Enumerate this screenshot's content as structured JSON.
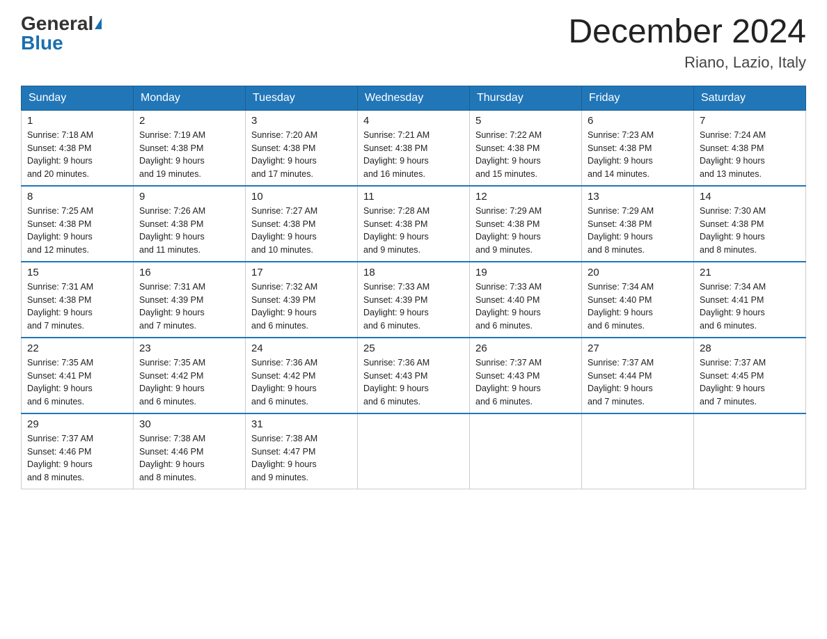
{
  "logo": {
    "general": "General",
    "blue": "Blue"
  },
  "title": "December 2024",
  "location": "Riano, Lazio, Italy",
  "days_of_week": [
    "Sunday",
    "Monday",
    "Tuesday",
    "Wednesday",
    "Thursday",
    "Friday",
    "Saturday"
  ],
  "weeks": [
    [
      {
        "day": "1",
        "sunrise": "7:18 AM",
        "sunset": "4:38 PM",
        "daylight": "9 hours and 20 minutes."
      },
      {
        "day": "2",
        "sunrise": "7:19 AM",
        "sunset": "4:38 PM",
        "daylight": "9 hours and 19 minutes."
      },
      {
        "day": "3",
        "sunrise": "7:20 AM",
        "sunset": "4:38 PM",
        "daylight": "9 hours and 17 minutes."
      },
      {
        "day": "4",
        "sunrise": "7:21 AM",
        "sunset": "4:38 PM",
        "daylight": "9 hours and 16 minutes."
      },
      {
        "day": "5",
        "sunrise": "7:22 AM",
        "sunset": "4:38 PM",
        "daylight": "9 hours and 15 minutes."
      },
      {
        "day": "6",
        "sunrise": "7:23 AM",
        "sunset": "4:38 PM",
        "daylight": "9 hours and 14 minutes."
      },
      {
        "day": "7",
        "sunrise": "7:24 AM",
        "sunset": "4:38 PM",
        "daylight": "9 hours and 13 minutes."
      }
    ],
    [
      {
        "day": "8",
        "sunrise": "7:25 AM",
        "sunset": "4:38 PM",
        "daylight": "9 hours and 12 minutes."
      },
      {
        "day": "9",
        "sunrise": "7:26 AM",
        "sunset": "4:38 PM",
        "daylight": "9 hours and 11 minutes."
      },
      {
        "day": "10",
        "sunrise": "7:27 AM",
        "sunset": "4:38 PM",
        "daylight": "9 hours and 10 minutes."
      },
      {
        "day": "11",
        "sunrise": "7:28 AM",
        "sunset": "4:38 PM",
        "daylight": "9 hours and 9 minutes."
      },
      {
        "day": "12",
        "sunrise": "7:29 AM",
        "sunset": "4:38 PM",
        "daylight": "9 hours and 9 minutes."
      },
      {
        "day": "13",
        "sunrise": "7:29 AM",
        "sunset": "4:38 PM",
        "daylight": "9 hours and 8 minutes."
      },
      {
        "day": "14",
        "sunrise": "7:30 AM",
        "sunset": "4:38 PM",
        "daylight": "9 hours and 8 minutes."
      }
    ],
    [
      {
        "day": "15",
        "sunrise": "7:31 AM",
        "sunset": "4:38 PM",
        "daylight": "9 hours and 7 minutes."
      },
      {
        "day": "16",
        "sunrise": "7:31 AM",
        "sunset": "4:39 PM",
        "daylight": "9 hours and 7 minutes."
      },
      {
        "day": "17",
        "sunrise": "7:32 AM",
        "sunset": "4:39 PM",
        "daylight": "9 hours and 6 minutes."
      },
      {
        "day": "18",
        "sunrise": "7:33 AM",
        "sunset": "4:39 PM",
        "daylight": "9 hours and 6 minutes."
      },
      {
        "day": "19",
        "sunrise": "7:33 AM",
        "sunset": "4:40 PM",
        "daylight": "9 hours and 6 minutes."
      },
      {
        "day": "20",
        "sunrise": "7:34 AM",
        "sunset": "4:40 PM",
        "daylight": "9 hours and 6 minutes."
      },
      {
        "day": "21",
        "sunrise": "7:34 AM",
        "sunset": "4:41 PM",
        "daylight": "9 hours and 6 minutes."
      }
    ],
    [
      {
        "day": "22",
        "sunrise": "7:35 AM",
        "sunset": "4:41 PM",
        "daylight": "9 hours and 6 minutes."
      },
      {
        "day": "23",
        "sunrise": "7:35 AM",
        "sunset": "4:42 PM",
        "daylight": "9 hours and 6 minutes."
      },
      {
        "day": "24",
        "sunrise": "7:36 AM",
        "sunset": "4:42 PM",
        "daylight": "9 hours and 6 minutes."
      },
      {
        "day": "25",
        "sunrise": "7:36 AM",
        "sunset": "4:43 PM",
        "daylight": "9 hours and 6 minutes."
      },
      {
        "day": "26",
        "sunrise": "7:37 AM",
        "sunset": "4:43 PM",
        "daylight": "9 hours and 6 minutes."
      },
      {
        "day": "27",
        "sunrise": "7:37 AM",
        "sunset": "4:44 PM",
        "daylight": "9 hours and 7 minutes."
      },
      {
        "day": "28",
        "sunrise": "7:37 AM",
        "sunset": "4:45 PM",
        "daylight": "9 hours and 7 minutes."
      }
    ],
    [
      {
        "day": "29",
        "sunrise": "7:37 AM",
        "sunset": "4:46 PM",
        "daylight": "9 hours and 8 minutes."
      },
      {
        "day": "30",
        "sunrise": "7:38 AM",
        "sunset": "4:46 PM",
        "daylight": "9 hours and 8 minutes."
      },
      {
        "day": "31",
        "sunrise": "7:38 AM",
        "sunset": "4:47 PM",
        "daylight": "9 hours and 9 minutes."
      },
      null,
      null,
      null,
      null
    ]
  ],
  "labels": {
    "sunrise": "Sunrise:",
    "sunset": "Sunset:",
    "daylight": "Daylight:"
  }
}
